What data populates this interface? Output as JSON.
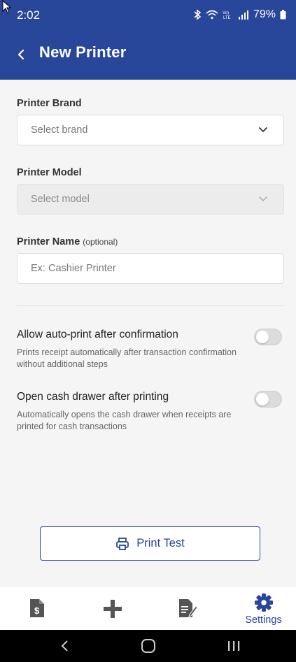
{
  "status": {
    "time": "2:02",
    "battery": "79%"
  },
  "header": {
    "title": "New Printer"
  },
  "form": {
    "brand": {
      "label": "Printer Brand",
      "placeholder": "Select brand"
    },
    "model": {
      "label": "Printer Model",
      "placeholder": "Select model"
    },
    "name": {
      "label": "Printer Name",
      "optional": "(optional)",
      "placeholder": "Ex: Cashier Printer"
    }
  },
  "toggles": [
    {
      "title": "Allow auto-print after confirmation",
      "description": "Prints receipt automatically after transaction confirmation without additional steps",
      "enabled": false
    },
    {
      "title": "Open cash drawer after printing",
      "description": "Automatically opens the cash drawer when receipts are printed for cash transactions",
      "enabled": false
    }
  ],
  "print_test": {
    "label": "Print Test"
  },
  "nav": {
    "settings_label": "Settings"
  },
  "colors": {
    "primary": "#28469a",
    "nav_icon": "#555555"
  }
}
